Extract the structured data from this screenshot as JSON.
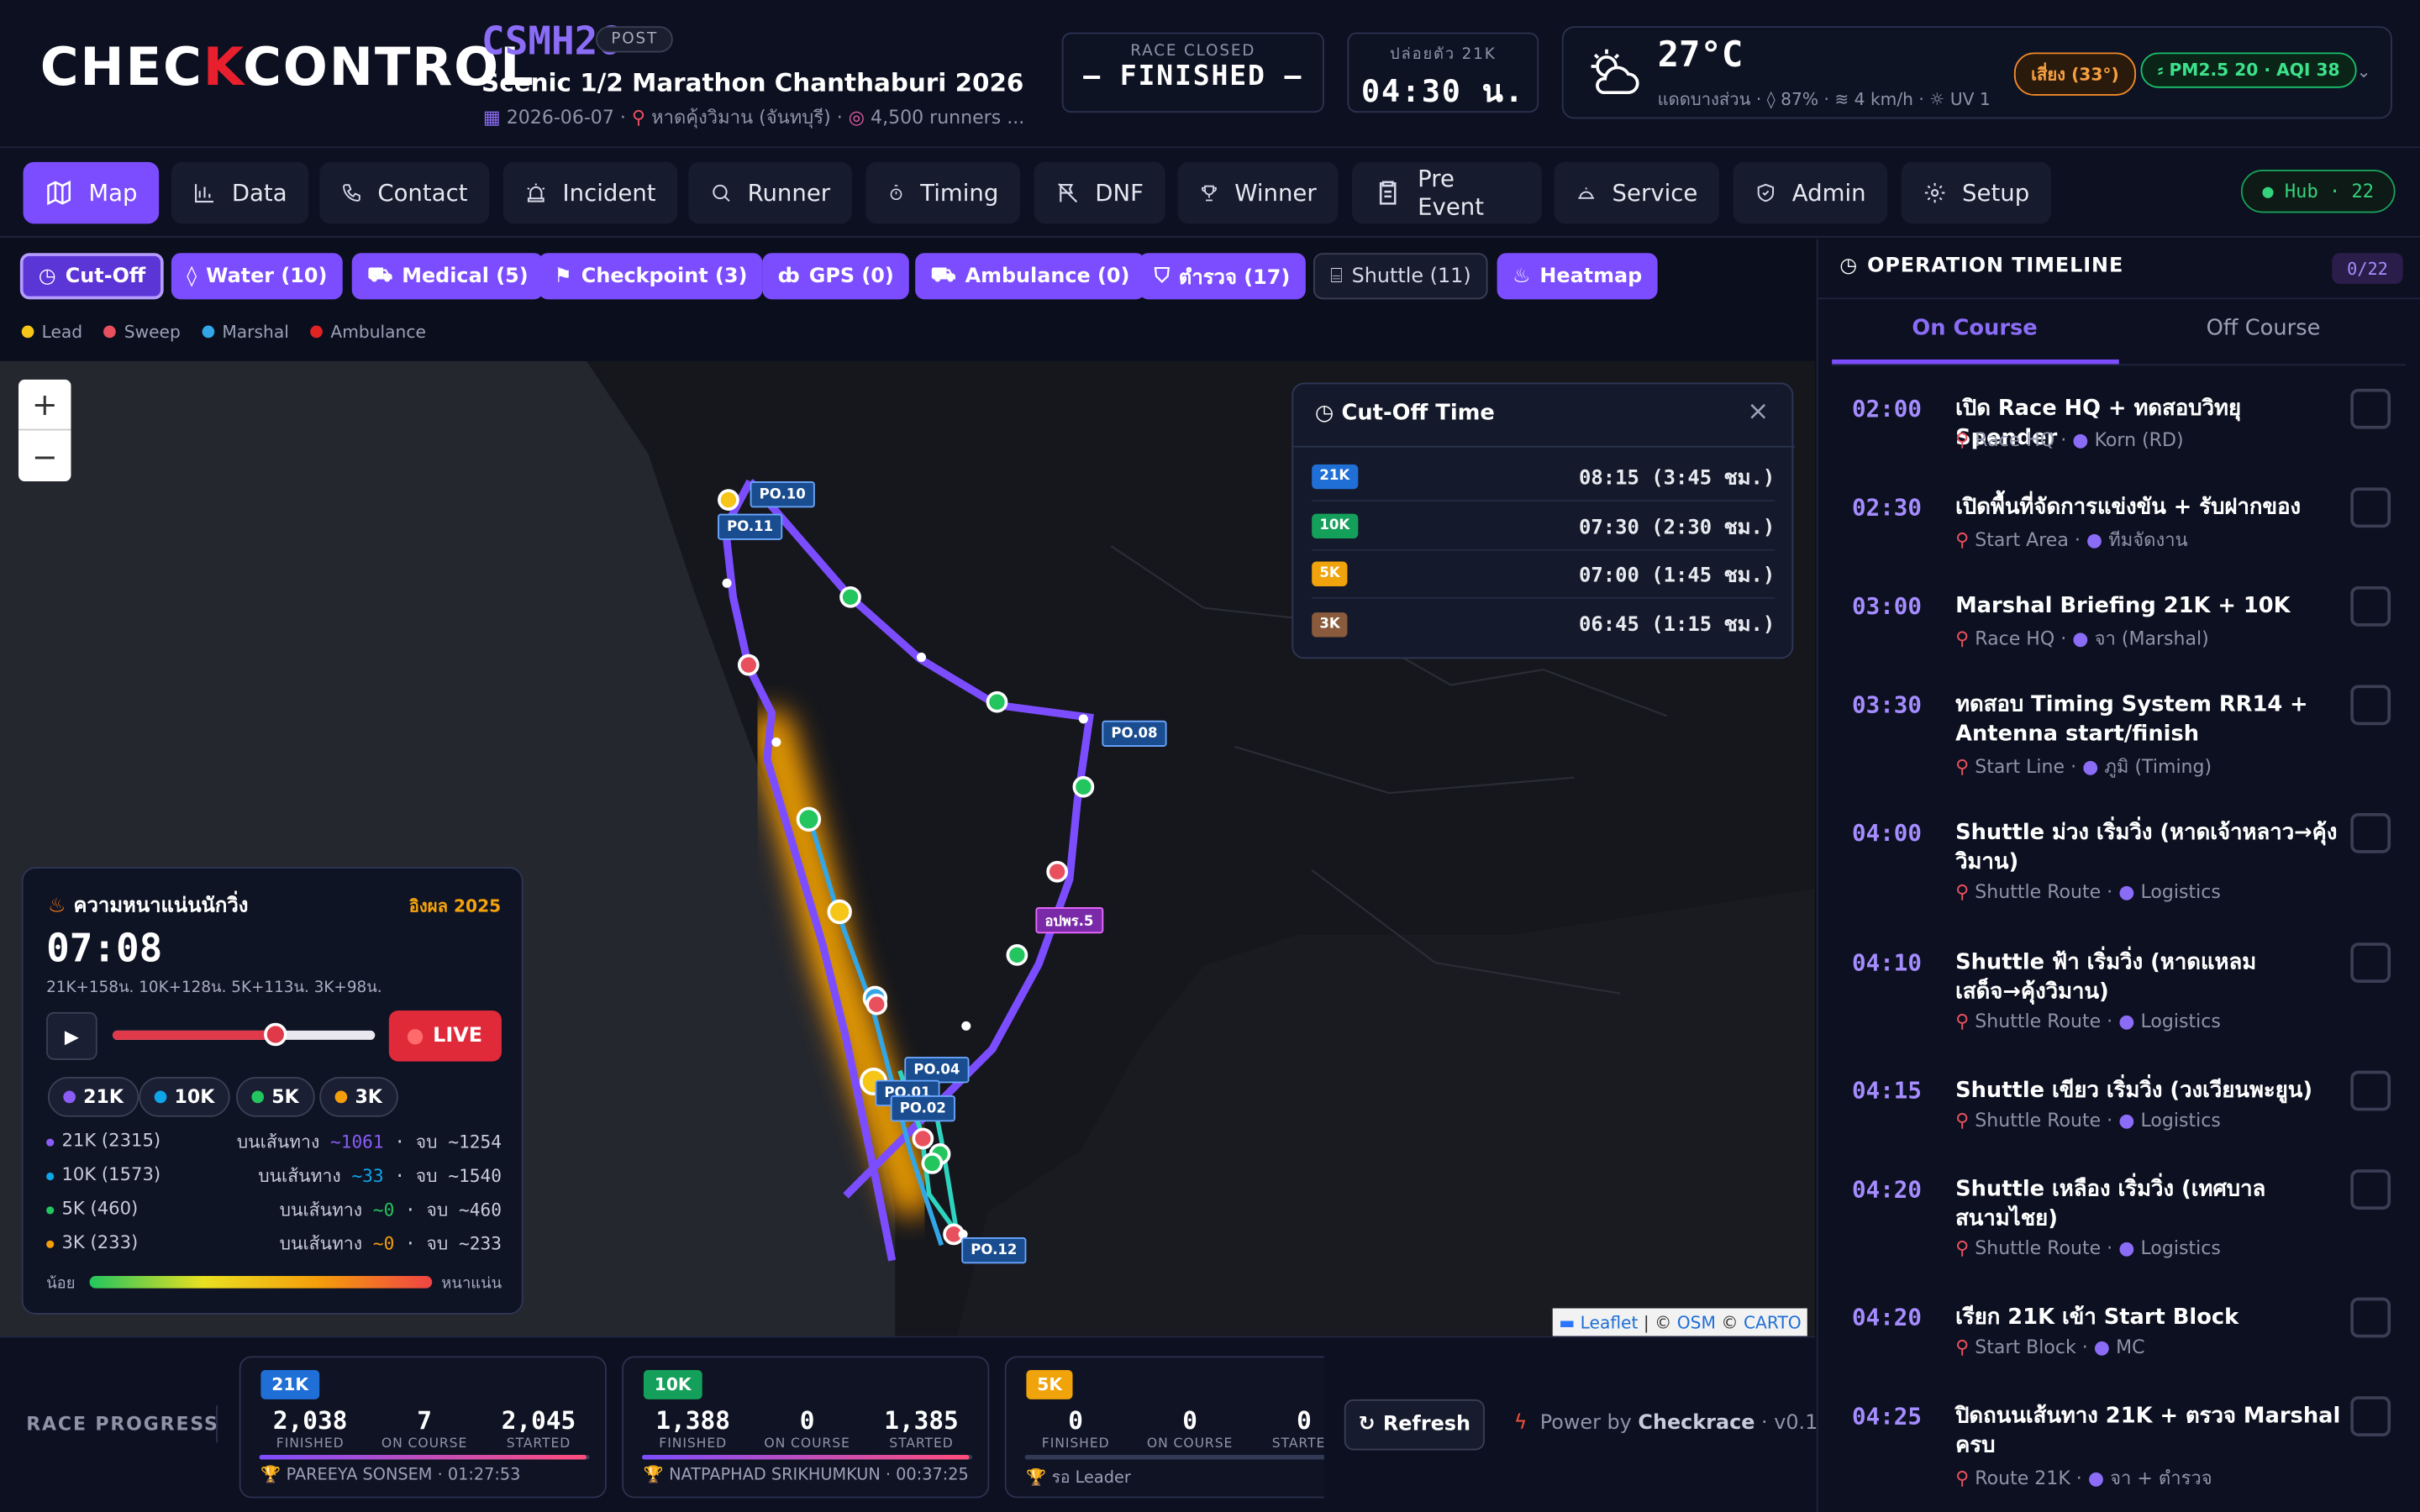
{
  "brand": {
    "logo_left": "CHEC",
    "logo_x": "K",
    "logo_right": "CONTROL"
  },
  "event": {
    "code": "CSMH26",
    "status_tag": "POST",
    "title": "Scenic 1/2 Marathon Chanthaburi 2026",
    "date": "2026-06-07",
    "location": "หาดคุ้งวิมาน (จันทบุรี)",
    "runners": "4,500 runners ..."
  },
  "race_box": {
    "label": "RACE CLOSED",
    "value": "— FINISHED —"
  },
  "start_box": {
    "label": "ปล่อยตัว 21K",
    "value": "04:30 น."
  },
  "weather": {
    "temp": "27°C",
    "desc": "แดดบางส่วน",
    "humidity": "87%",
    "wind": "4 km/h",
    "uv": "UV 1",
    "risk": "เสี่ยง (33°)",
    "aqi": "PM2.5 20 · AQI 38"
  },
  "nav": {
    "items": [
      "Map",
      "Data",
      "Contact",
      "Incident",
      "Runner",
      "Timing",
      "DNF",
      "Winner",
      "Pre Event",
      "Service",
      "Admin",
      "Setup"
    ],
    "hub": "● Hub · 22"
  },
  "filters": [
    "Cut-Off",
    "Water (10)",
    "Medical (5)",
    "Checkpoint (3)",
    "GPS (0)",
    "Ambulance (0)",
    "ตำรวจ (17)",
    "Shuttle (11)",
    "Heatmap"
  ],
  "legend": [
    "Lead",
    "Sweep",
    "Marshal",
    "Ambulance"
  ],
  "colors": {
    "accent": "#7c4dff",
    "lead": "#f5c518",
    "sweep": "#e8505e",
    "marshal": "#33a6e8",
    "ambulance": "#e02424",
    "21k": "#8b5cf6",
    "10k": "#0ea5e9",
    "5k": "#22c55e",
    "3k": "#f59e0b"
  },
  "map": {
    "zoom_in": "+",
    "zoom_out": "−",
    "labels": [
      "PO.10",
      "PO.11",
      "PO.08",
      "อปพร.5",
      "PO.04",
      "PO.01",
      "PO.02",
      "PO.12"
    ],
    "attribution": {
      "leaflet": "Leaflet",
      "osm": "OSM",
      "carto": "CARTO",
      "sep": "|",
      "copy": "©"
    }
  },
  "cutoff": {
    "title": "Cut-Off Time",
    "rows": [
      {
        "dist": "21K",
        "time": "08:15 (3:45 ชม.)",
        "color": "#1f6fd6"
      },
      {
        "dist": "10K",
        "time": "07:30 (2:30 ชม.)",
        "color": "#14a05a"
      },
      {
        "dist": "5K",
        "time": "07:00 (1:45 ชม.)",
        "color": "#f0a30a"
      },
      {
        "dist": "3K",
        "time": "06:45 (1:15 ชม.)",
        "color": "#8a5a3c"
      }
    ]
  },
  "density": {
    "title": "ความหนาแน่นนักวิ่ง",
    "ref": "อิงผล 2025",
    "time": "07:08",
    "note": "21K+158น. 10K+128น. 5K+113น. 3K+98น.",
    "live": "LIVE",
    "slider": 0.62,
    "chips": [
      "21K",
      "10K",
      "5K",
      "3K"
    ],
    "rows": [
      {
        "name": "21K (2315)",
        "on": "~1061",
        "fin": "~1254",
        "color": "#8b5cf6"
      },
      {
        "name": "10K (1573)",
        "on": "~33",
        "fin": "~1540",
        "color": "#0ea5e9"
      },
      {
        "name": "5K (460)",
        "on": "~0",
        "fin": "~460",
        "color": "#22c55e"
      },
      {
        "name": "3K (233)",
        "on": "~0",
        "fin": "~233",
        "color": "#f59e0b"
      }
    ],
    "on_label": "บนเส้นทาง",
    "fin_label": "จบ",
    "scale_low": "น้อย",
    "scale_high": "หนาแน่น"
  },
  "progress": {
    "label": "RACE PROGRESS",
    "cards": [
      {
        "dist": "21K",
        "color": "#1f6fd6",
        "finished": "2,038",
        "on_course": "7",
        "started": "2,045",
        "winner": "PAREEYA SONSEM · 01:27:53",
        "pct": 0.99
      },
      {
        "dist": "10K",
        "color": "#14a05a",
        "finished": "1,388",
        "on_course": "0",
        "started": "1,385",
        "winner": "NATPAPHAD SRIKHUMKUN · 00:37:25",
        "pct": 0.99
      },
      {
        "dist": "5K",
        "color": "#f0a30a",
        "finished": "0",
        "on_course": "0",
        "started": "0",
        "winner": "รอ Leader",
        "pct": 0
      }
    ],
    "sub": {
      "finished": "FINISHED",
      "on_course": "ON COURSE",
      "started": "STARTED"
    },
    "refresh": "Refresh",
    "power": "Power by",
    "power_brand": "Checkrace",
    "version": "v0.1"
  },
  "timeline": {
    "title": "OPERATION TIMELINE",
    "count": "0/22",
    "tabs": [
      "On Course",
      "Off Course"
    ],
    "items": [
      {
        "time": "02:00",
        "title": "เปิด Race HQ + ทดสอบวิทยุ Spender",
        "loc": "Race HQ",
        "who": "Korn (RD)"
      },
      {
        "time": "02:30",
        "title": "เปิดพื้นที่จัดการแข่งขัน + รับฝากของ",
        "loc": "Start Area",
        "who": "ทีมจัดงาน"
      },
      {
        "time": "03:00",
        "title": "Marshal Briefing 21K + 10K",
        "loc": "Race HQ",
        "who": "จา (Marshal)"
      },
      {
        "time": "03:30",
        "title": "ทดสอบ Timing System RR14 + Antenna start/finish",
        "loc": "Start Line",
        "who": "ภูมิ (Timing)"
      },
      {
        "time": "04:00",
        "title": "Shuttle ม่วง เริ่มวิ่ง (หาดเจ้าหลาว→คุ้งวิมาน)",
        "loc": "Shuttle Route",
        "who": "Logistics"
      },
      {
        "time": "04:10",
        "title": "Shuttle ฟ้า เริ่มวิ่ง (หาดแหลมเสด็จ→คุ้งวิมาน)",
        "loc": "Shuttle Route",
        "who": "Logistics"
      },
      {
        "time": "04:15",
        "title": "Shuttle เขียว เริ่มวิ่ง (วงเวียนพะยูน)",
        "loc": "Shuttle Route",
        "who": "Logistics"
      },
      {
        "time": "04:20",
        "title": "Shuttle เหลือง เริ่มวิ่ง (เทศบาลสนามไชย)",
        "loc": "Shuttle Route",
        "who": "Logistics"
      },
      {
        "time": "04:20",
        "title": "เรียก 21K เข้า Start Block",
        "loc": "Start Block",
        "who": "MC"
      },
      {
        "time": "04:25",
        "title": "ปิดถนนเส้นทาง 21K + ตรวจ Marshal ครบ",
        "loc": "Route 21K",
        "who": "จา + ตำรวจ"
      }
    ]
  }
}
